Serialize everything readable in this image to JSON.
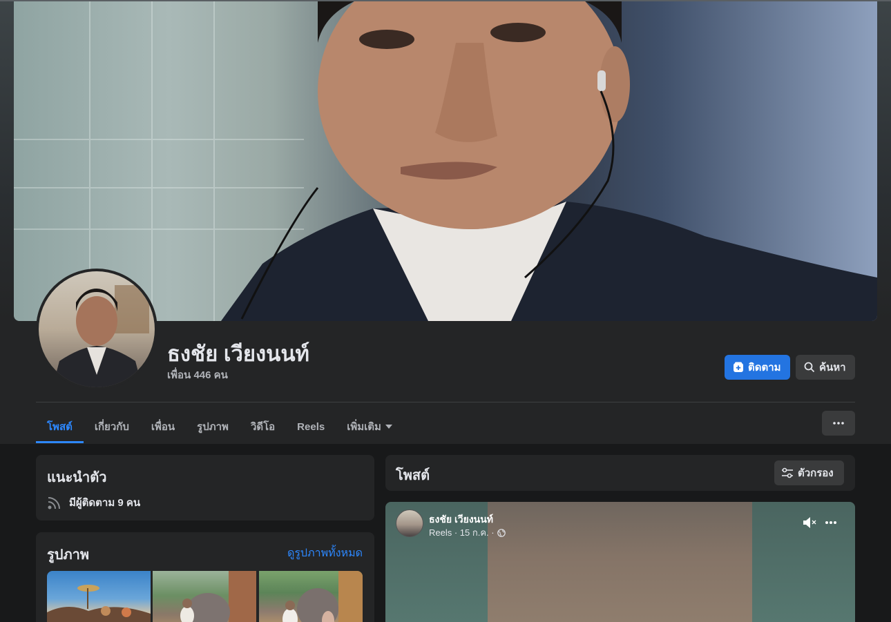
{
  "profile": {
    "name": "ธงชัย เวียงนนท์",
    "friends": "เพื่อน 446 คน"
  },
  "actions": {
    "follow_label": "ติดตาม",
    "search_label": "ค้นหา"
  },
  "tabs": [
    {
      "label": "โพสต์",
      "active": true
    },
    {
      "label": "เกี่ยวกับ"
    },
    {
      "label": "เพื่อน"
    },
    {
      "label": "รูปภาพ"
    },
    {
      "label": "วิดีโอ"
    },
    {
      "label": "Reels"
    },
    {
      "label": "เพิ่มเติม"
    }
  ],
  "intro": {
    "title": "แนะนำตัว",
    "followers": "มีผู้ติดตาม 9 คน"
  },
  "photos": {
    "title": "รูปภาพ",
    "see_all": "ดูรูปภาพทั้งหมด"
  },
  "posts": {
    "title": "โพสต์",
    "filter_label": "ตัวกรอง",
    "items": [
      {
        "author": "ธงชัย เวียงนนท์",
        "meta": "Reels · 15 ก.ค. ·"
      }
    ]
  },
  "colors": {
    "accent": "#2d88ff",
    "follow_bg": "#2374e1",
    "card_bg": "#242526",
    "page_bg": "#18191a"
  }
}
